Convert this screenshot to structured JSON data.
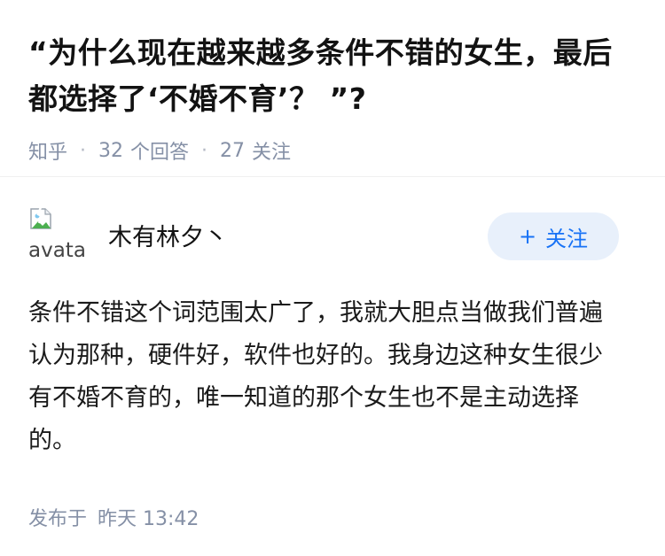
{
  "question": {
    "title": "“为什么现在越来越多条件不错的女生，最后都选择了‘不婚不育’？ ”?",
    "source": "知乎",
    "answer_count": "32",
    "answer_label": "个回答",
    "follow_count": "27",
    "follow_label": "关注"
  },
  "answer": {
    "author_name": "木有林夕丶",
    "avatar_alt": "avatar",
    "follow_button": "关注",
    "follow_button_plus": "+",
    "content": "条件不错这个词范围太广了，我就大胆点当做我们普遍认为那种，硬件好，软件也好的。我身边这种女生很少有不婚不育的，唯一知道的那个女生也不是主动选择的。",
    "published_label": "发布于",
    "published_time": "昨天 13:42"
  }
}
